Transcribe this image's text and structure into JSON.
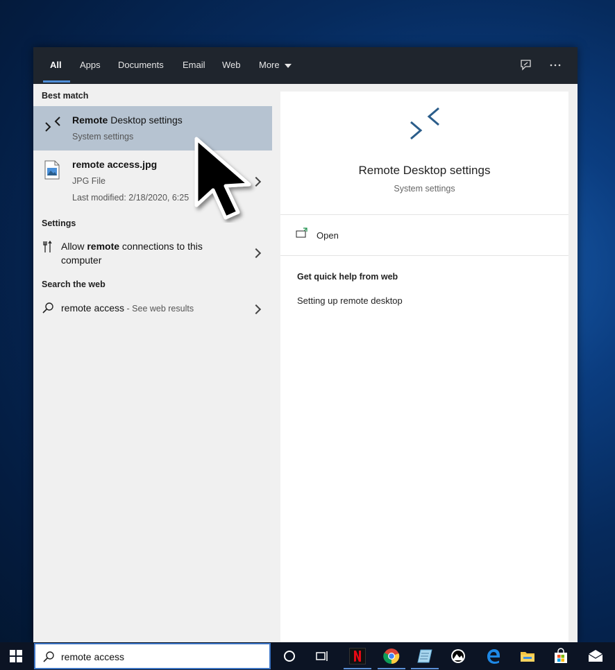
{
  "tabs": [
    {
      "label": "All"
    },
    {
      "label": "Apps"
    },
    {
      "label": "Documents"
    },
    {
      "label": "Email"
    },
    {
      "label": "Web"
    },
    {
      "label": "More"
    }
  ],
  "left": {
    "best_match_header": "Best match",
    "best_match": {
      "title_bold": "Remote",
      "title_rest": " Desktop settings",
      "subtitle": "System settings"
    },
    "file": {
      "title": "remote access.jpg",
      "type": "JPG File",
      "modified": "Last modified: 2/18/2020, 6:25"
    },
    "settings_header": "Settings",
    "settings_item": {
      "prefix": "Allow ",
      "bold": "remote",
      "suffix": " connections to this",
      "line2": "computer"
    },
    "web_header": "Search the web",
    "web_item": {
      "query": "remote access",
      "hint": " - See web results"
    }
  },
  "detail": {
    "title": "Remote Desktop settings",
    "subtitle": "System settings",
    "open_label": "Open",
    "quick_help_header": "Get quick help from web",
    "quick_help_link": "Setting up remote desktop"
  },
  "taskbar": {
    "search_value": "remote access"
  },
  "colors": {
    "accent": "#4f8fd9",
    "selected_bg": "#b6c3d1",
    "topbar_bg": "#1f252d",
    "icon_blue": "#2b5d8a"
  }
}
